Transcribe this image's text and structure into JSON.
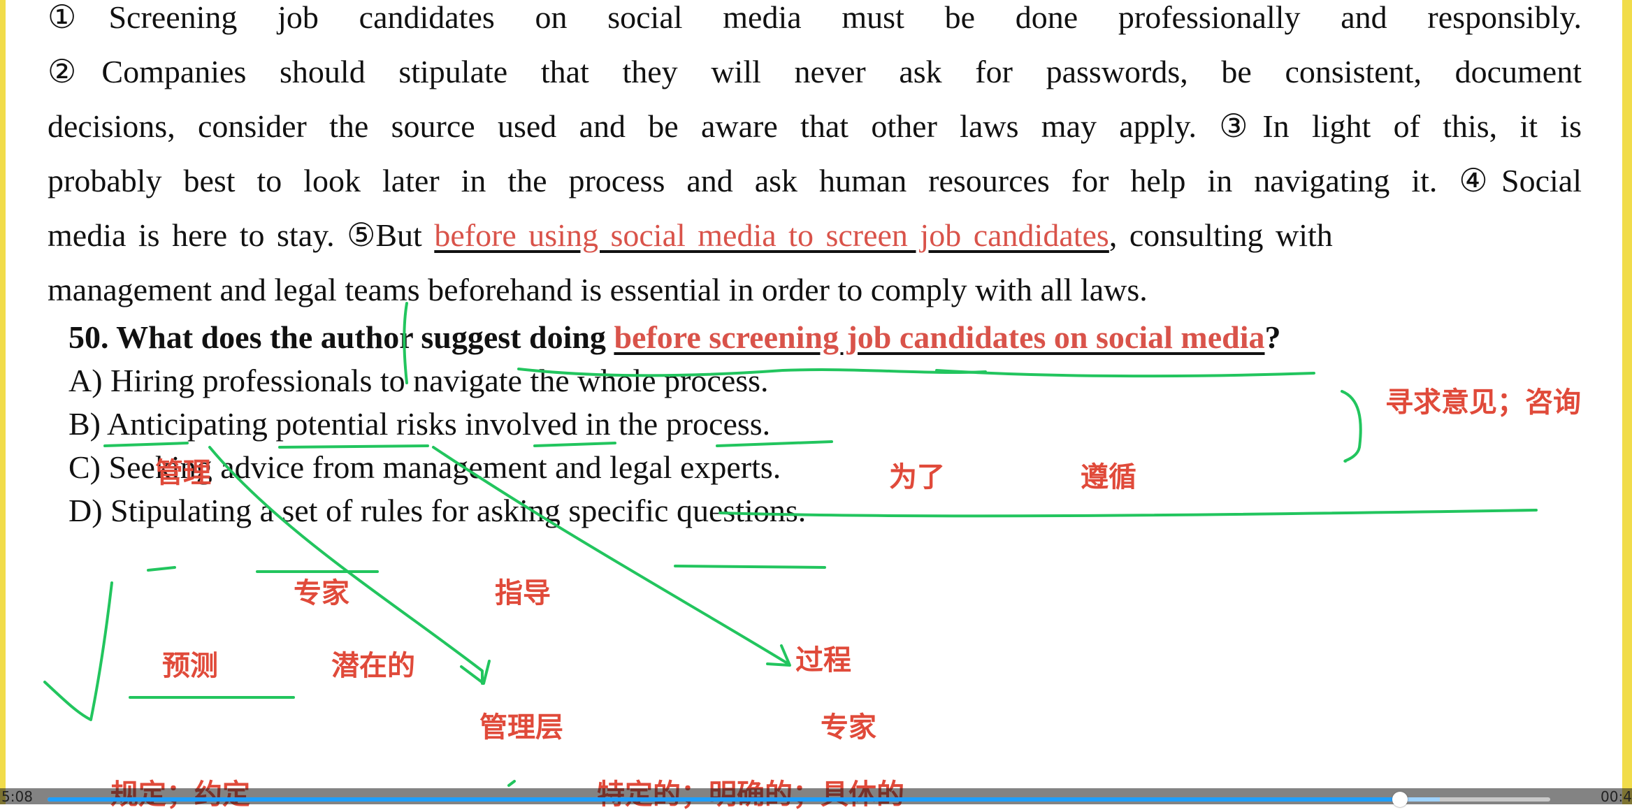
{
  "passage": {
    "line1": "①Screening job candidates on social media must be done professionally and responsibly.",
    "line2": "②Companies should stipulate that they will never ask for passwords, be consistent, document",
    "line3": "decisions, consider the source used and be aware that other laws may apply. ③In light of this, it is",
    "line4": "probably best to look later in the process and ask human resources for help in navigating it. ④Social",
    "line5_pre": "media is here to stay. ⑤But ",
    "line5_hl": "before using social media to screen job candidates",
    "line5_post": ", consulting with",
    "line6": "management and legal teams beforehand is essential in order to comply with all laws."
  },
  "question": {
    "pre": "50. What does the author suggest doing ",
    "hl": "before screening job candidates on social media",
    "post": "?"
  },
  "options": [
    "A) Hiring professionals to navigate the whole process.",
    "B) Anticipating potential risks involved in the process.",
    "C) Seeking advice from management and legal experts.",
    "D) Stipulating a set of rules for asking specific questions."
  ],
  "annotations": {
    "consult": "寻求意见；咨询",
    "management": "管理",
    "in_order_to": "为了",
    "comply": "遵循",
    "professionals": "专家",
    "navigate": "指导",
    "anticipating": "预测",
    "potential": "潜在的",
    "process": "过程",
    "management_level": "管理层",
    "experts": "专家",
    "stipulate": "规定；约定",
    "specific": "特定的；明确的；具体的"
  },
  "player": {
    "elapsed": "5:08",
    "total": "00:4",
    "progress": 0.9
  },
  "colors": {
    "annotation_red": "#e04a3a",
    "ink_green": "#22c55e",
    "progress_blue": "#1e9fff",
    "edge_yellow": "#f1dc4a"
  }
}
